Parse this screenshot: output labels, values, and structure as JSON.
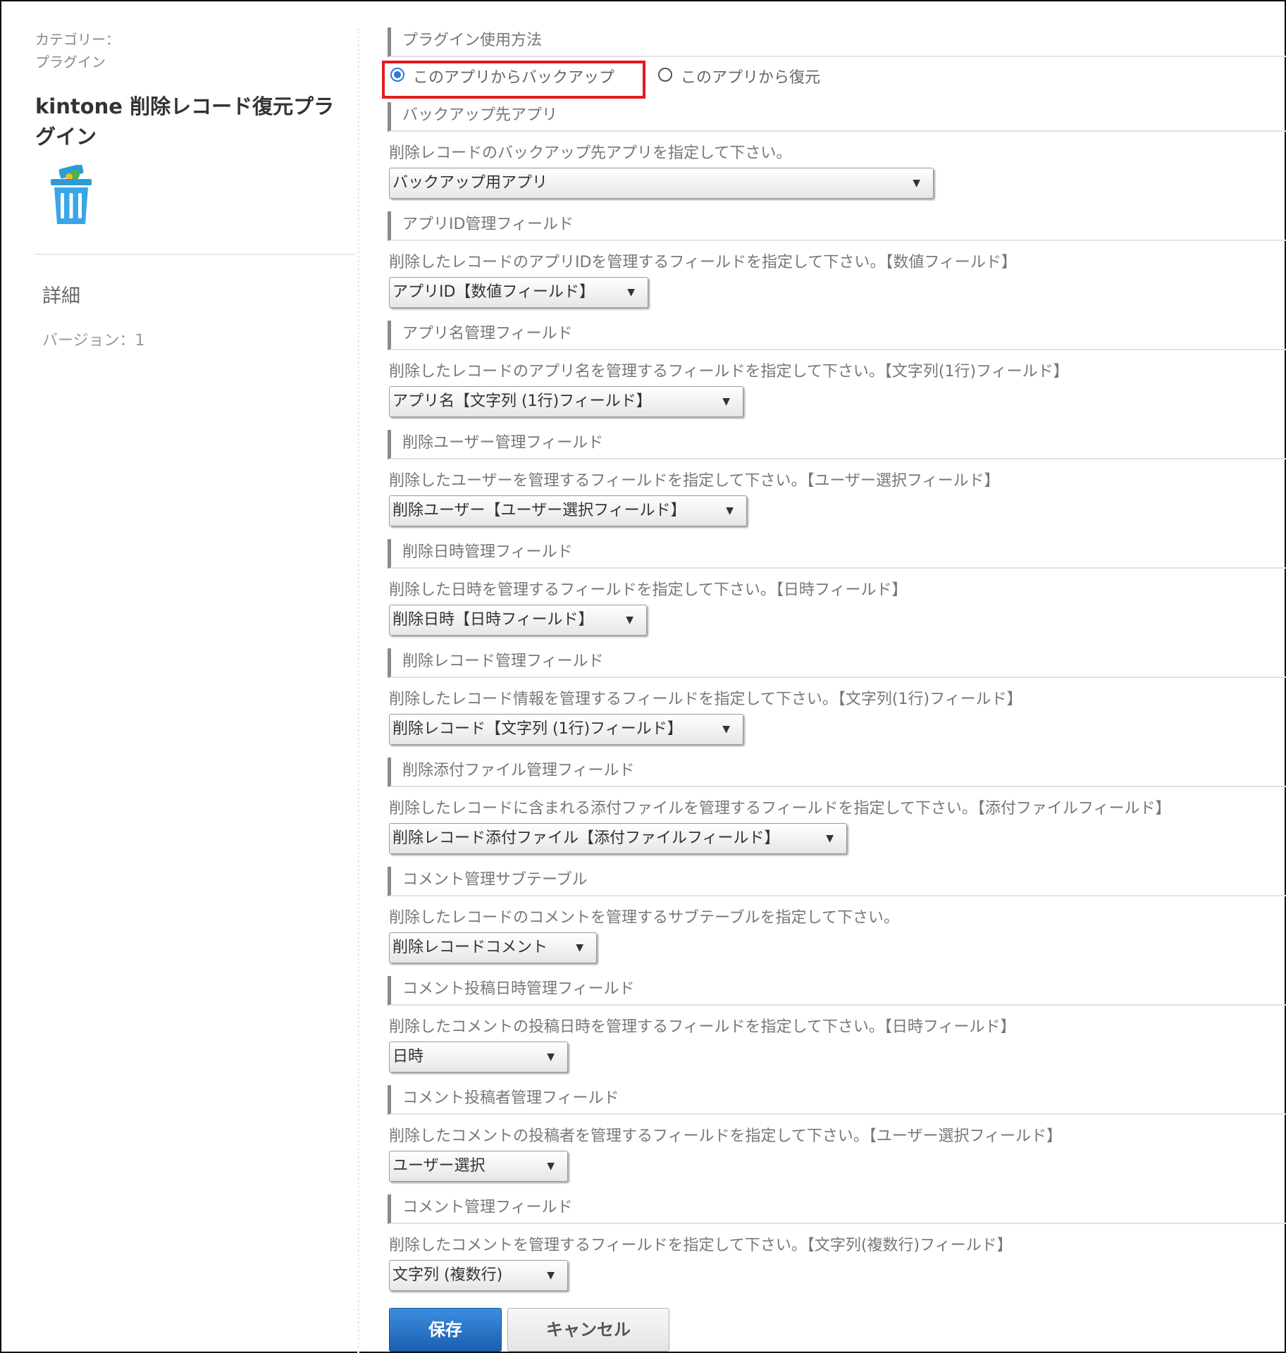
{
  "sidebar": {
    "category_label": "カテゴリー：",
    "category_value": "プラグイン",
    "plugin_title": "kintone 削除レコード復元プラグイン",
    "icon": "trash-icon",
    "detail_heading": "詳細",
    "version": "バージョン：1"
  },
  "usage": {
    "heading": "プラグイン使用方法",
    "option_backup": "このアプリからバックアップ",
    "option_restore": "このアプリから復元",
    "selected": "このアプリからバックアップ",
    "highlight_color": "#e6191e"
  },
  "sections": [
    {
      "heading": "バックアップ先アプリ",
      "desc": "削除レコードのバックアップ先アプリを指定して下さい。",
      "value": "バックアップ用アプリ"
    },
    {
      "heading": "アプリID管理フィールド",
      "desc": "削除したレコードのアプリIDを管理するフィールドを指定して下さい。【数値フィールド】",
      "value": "アプリID【数値フィールド】"
    },
    {
      "heading": "アプリ名管理フィールド",
      "desc": "削除したレコードのアプリ名を管理するフィールドを指定して下さい。【文字列(1行)フィールド】",
      "value": "アプリ名【文字列 (1行)フィールド】"
    },
    {
      "heading": "削除ユーザー管理フィールド",
      "desc": "削除したユーザーを管理するフィールドを指定して下さい。【ユーザー選択フィールド】",
      "value": "削除ユーザー【ユーザー選択フィールド】"
    },
    {
      "heading": "削除日時管理フィールド",
      "desc": "削除した日時を管理するフィールドを指定して下さい。【日時フィールド】",
      "value": "削除日時【日時フィールド】"
    },
    {
      "heading": "削除レコード管理フィールド",
      "desc": "削除したレコード情報を管理するフィールドを指定して下さい。【文字列(1行)フィールド】",
      "value": "削除レコード【文字列 (1行)フィールド】"
    },
    {
      "heading": "削除添付ファイル管理フィールド",
      "desc": "削除したレコードに含まれる添付ファイルを管理するフィールドを指定して下さい。【添付ファイルフィールド】",
      "value": "削除レコード添付ファイル【添付ファイルフィールド】"
    },
    {
      "heading": "コメント管理サブテーブル",
      "desc": "削除したレコードのコメントを管理するサブテーブルを指定して下さい。",
      "value": "削除レコードコメント"
    },
    {
      "heading": "コメント投稿日時管理フィールド",
      "desc": "削除したコメントの投稿日時を管理するフィールドを指定して下さい。【日時フィールド】",
      "value": "日時"
    },
    {
      "heading": "コメント投稿者管理フィールド",
      "desc": "削除したコメントの投稿者を管理するフィールドを指定して下さい。【ユーザー選択フィールド】",
      "value": "ユーザー選択"
    },
    {
      "heading": "コメント管理フィールド",
      "desc": "削除したコメントを管理するフィールドを指定して下さい。【文字列(複数行)フィールド】",
      "value": "文字列 (複数行)"
    }
  ],
  "buttons": {
    "save": "保存",
    "cancel": "キャンセル"
  },
  "colors": {
    "save_button": "#1c5fb0",
    "radio_selected": "#2a7ad6"
  }
}
